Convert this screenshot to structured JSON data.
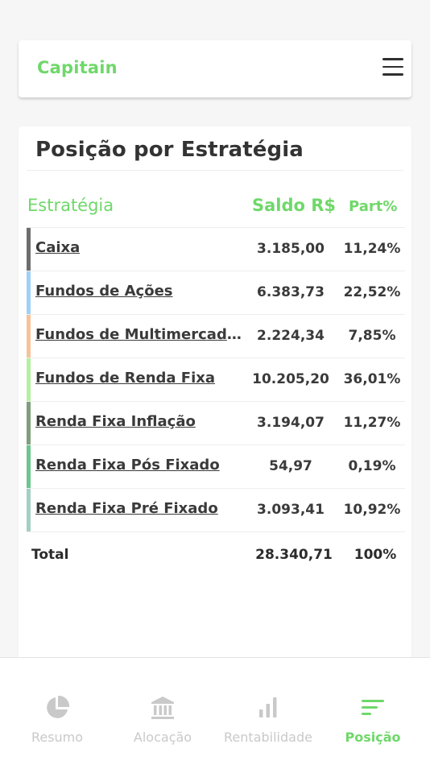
{
  "header": {
    "brand": "Capitain",
    "menu_icon": "hamburger-menu-icon"
  },
  "card": {
    "title": "Posição por Estratégia",
    "columns": {
      "strategy": "Estratégia",
      "saldo": "Saldo R$",
      "part": "Part%"
    },
    "rows": [
      {
        "name": "Caixa",
        "saldo": "3.185,00",
        "part": "11,24%",
        "color": "#6e6e6e"
      },
      {
        "name": "Fundos de Ações",
        "saldo": "6.383,73",
        "part": "22,52%",
        "color": "#9fd0f5"
      },
      {
        "name": "Fundos de Multimercad...",
        "saldo": "2.224,34",
        "part": "7,85%",
        "color": "#f7c29a"
      },
      {
        "name": "Fundos de Renda Fixa",
        "saldo": "10.205,20",
        "part": "36,01%",
        "color": "#b4f0a2"
      },
      {
        "name": "Renda Fixa Inflação",
        "saldo": "3.194,07",
        "part": "11,27%",
        "color": "#7f9f7c"
      },
      {
        "name": "Renda Fixa Pós Fixado",
        "saldo": "54,97",
        "part": "0,19%",
        "color": "#6dc590"
      },
      {
        "name": "Renda Fixa Pré Fixado",
        "saldo": "3.093,41",
        "part": "10,92%",
        "color": "#a3d0c3"
      }
    ],
    "total": {
      "label": "Total",
      "saldo": "28.340,71",
      "part": "100%"
    }
  },
  "bottom_nav": {
    "items": [
      {
        "label": "Resumo",
        "icon": "pie-chart-icon",
        "active": false
      },
      {
        "label": "Alocação",
        "icon": "bank-icon",
        "active": false
      },
      {
        "label": "Rentabilidade",
        "icon": "bar-chart-icon",
        "active": false
      },
      {
        "label": "Posição",
        "icon": "sort-lines-icon",
        "active": true
      }
    ]
  },
  "colors": {
    "accent": "#6fd86a",
    "inactive": "#c9c9c9"
  }
}
